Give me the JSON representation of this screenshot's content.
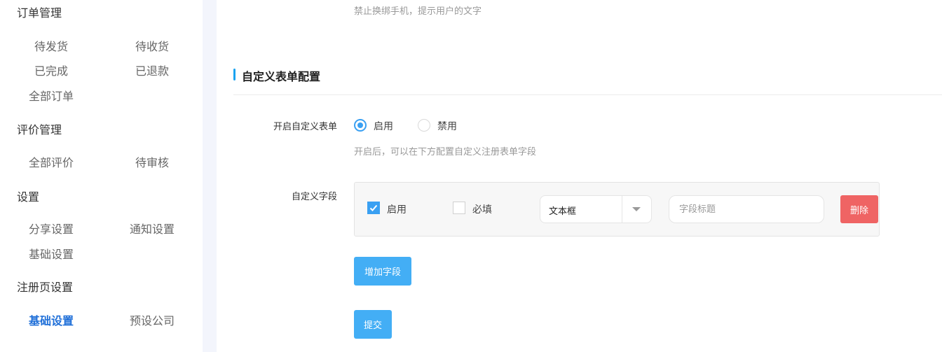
{
  "sidebar": {
    "sections": [
      {
        "title": "订单管理",
        "items": [
          "待发货",
          "待收货",
          "已完成",
          "已退款",
          "全部订单"
        ]
      },
      {
        "title": "评价管理",
        "items": [
          "全部评价",
          "待审核"
        ]
      },
      {
        "title": "设置",
        "items": [
          "分享设置",
          "通知设置",
          "基础设置"
        ]
      },
      {
        "title": "注册页设置",
        "items": [
          "基础设置",
          "预设公司"
        ]
      }
    ],
    "active_item": "基础设置"
  },
  "main": {
    "top_hint": "禁止换绑手机，提示用户的文字",
    "section_title": "自定义表单配置",
    "enable_form": {
      "label": "开启自定义表单",
      "options": [
        "启用",
        "禁用"
      ],
      "selected": "启用",
      "hint": "开启后，可以在下方配置自定义注册表单字段"
    },
    "custom_field": {
      "label": "自定义字段",
      "enable_label": "启用",
      "enable_checked": true,
      "required_label": "必填",
      "required_checked": false,
      "type_value": "文本框",
      "title_placeholder": "字段标题",
      "delete_label": "删除"
    },
    "add_field_label": "增加字段",
    "submit_label": "提交"
  },
  "colors": {
    "accent": "#3aa0f2",
    "button": "#43aef5",
    "danger": "#ef6464",
    "active_nav": "#1f6fd8"
  }
}
